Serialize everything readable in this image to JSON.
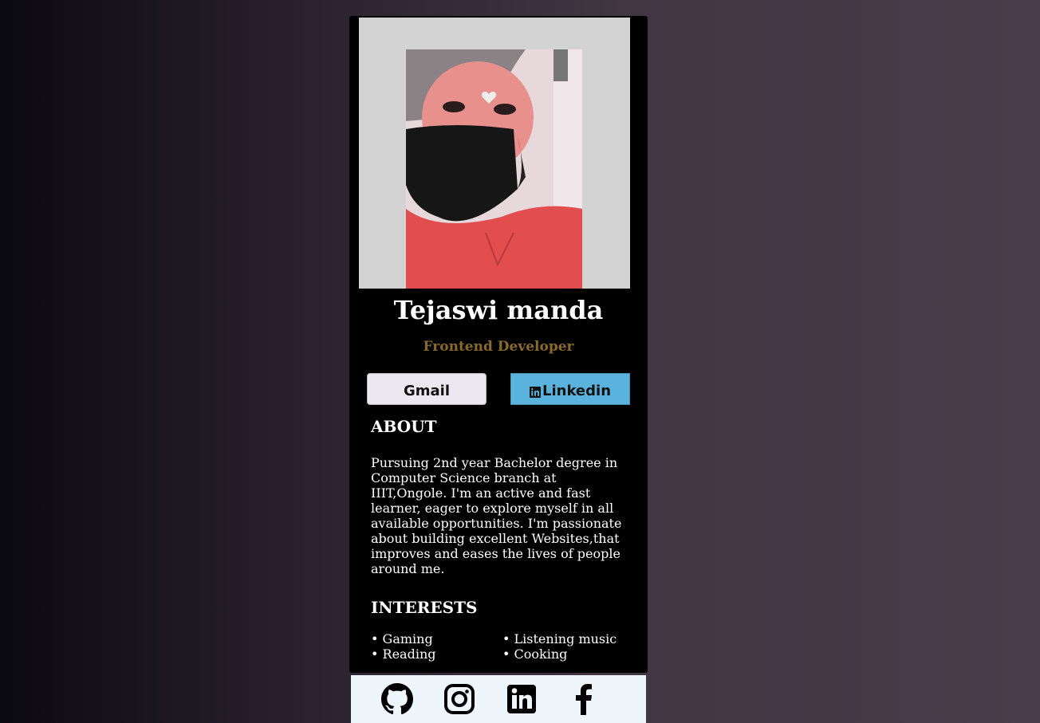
{
  "profile": {
    "name": "Tejaswi manda",
    "role": "Frontend Developer"
  },
  "buttons": {
    "gmail": "Gmail",
    "linkedin": "Linkedin"
  },
  "about": {
    "title": "ABOUT",
    "text": "Pursuing 2nd year Bachelor degree in Computer Science branch at IIIT,Ongole. I'm an active and fast learner, eager to explore myself in all available opportunities. I'm passionate about building excellent Websites,that improves and eases the lives of people around me."
  },
  "interests": {
    "title": "INTERESTS",
    "items": [
      "Gaming",
      "Listening music",
      "Reading",
      "Cooking"
    ]
  },
  "footer": {
    "icons": [
      "github-icon",
      "instagram-icon",
      "linkedin-icon",
      "facebook-icon"
    ]
  },
  "colors": {
    "card_bg": "#000000",
    "role": "#8a6a2a",
    "linkedin_button": "#5ab3dd",
    "footer_bg": "#eef5fb"
  }
}
